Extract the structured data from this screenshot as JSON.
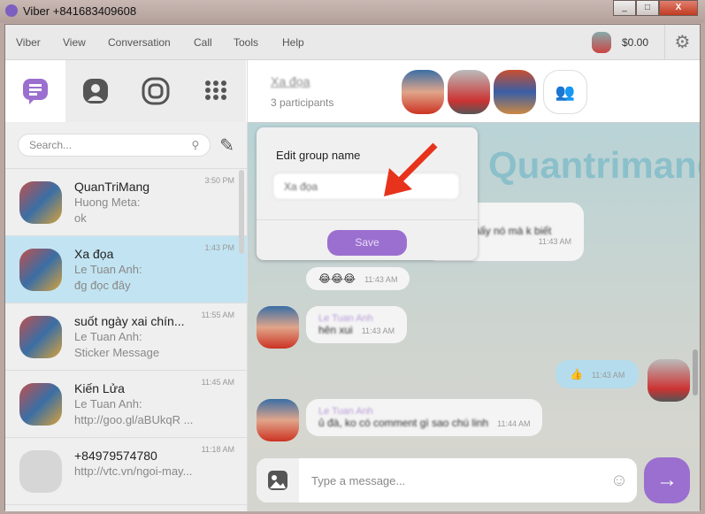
{
  "window": {
    "title": "Viber +841683409608",
    "min": "_",
    "max": "□",
    "close": "X"
  },
  "menu": [
    "Viber",
    "View",
    "Conversation",
    "Call",
    "Tools",
    "Help"
  ],
  "account": {
    "balance": "$0.00"
  },
  "search": {
    "placeholder": "Search..."
  },
  "conversations": [
    {
      "name": "QuanTriMang",
      "sender": "Huong Meta:",
      "preview": "ok",
      "time": "3:50 PM"
    },
    {
      "name": "Xa đọa",
      "sender": "Le Tuan Anh:",
      "preview": "đg đọc đây",
      "time": "1:43 PM",
      "selected": true
    },
    {
      "name": "suốt ngày xai chín...",
      "sender": "Le Tuan Anh:",
      "preview": "Sticker Message",
      "time": "11:55 AM"
    },
    {
      "name": "Kiến Lửa",
      "sender": "Le Tuan Anh:",
      "preview": "http://goo.gl/aBUkqR ...",
      "time": "11:45 AM"
    },
    {
      "name": "+84979574780",
      "sender": "http://vtc.vn/ngoi-may...",
      "preview": "",
      "time": "11:18 AM"
    }
  ],
  "chat": {
    "group_name": "Xa đọa",
    "participants": "3 participants",
    "watermark": "Quantrimang",
    "messages": [
      {
        "text": "mấy nó mà k biết",
        "time": "11:43 AM"
      },
      {
        "text": "😂😂😂",
        "time": "11:43 AM"
      },
      {
        "sender": "Le Tuan Anh",
        "text": "hên xui",
        "time": "11:43 AM"
      },
      {
        "text": "👍",
        "time": "11:43 AM"
      },
      {
        "sender": "Le Tuan Anh",
        "text": "ủ đà, ko có comment gì sao chú linh",
        "time": "11:44 AM"
      }
    ],
    "input_placeholder": "Type a message..."
  },
  "popup": {
    "label": "Edit group name",
    "value": "Xa đọa",
    "save": "Save"
  },
  "colors": {
    "accent": "#9b6fd0",
    "selected": "#c2e4f2"
  }
}
